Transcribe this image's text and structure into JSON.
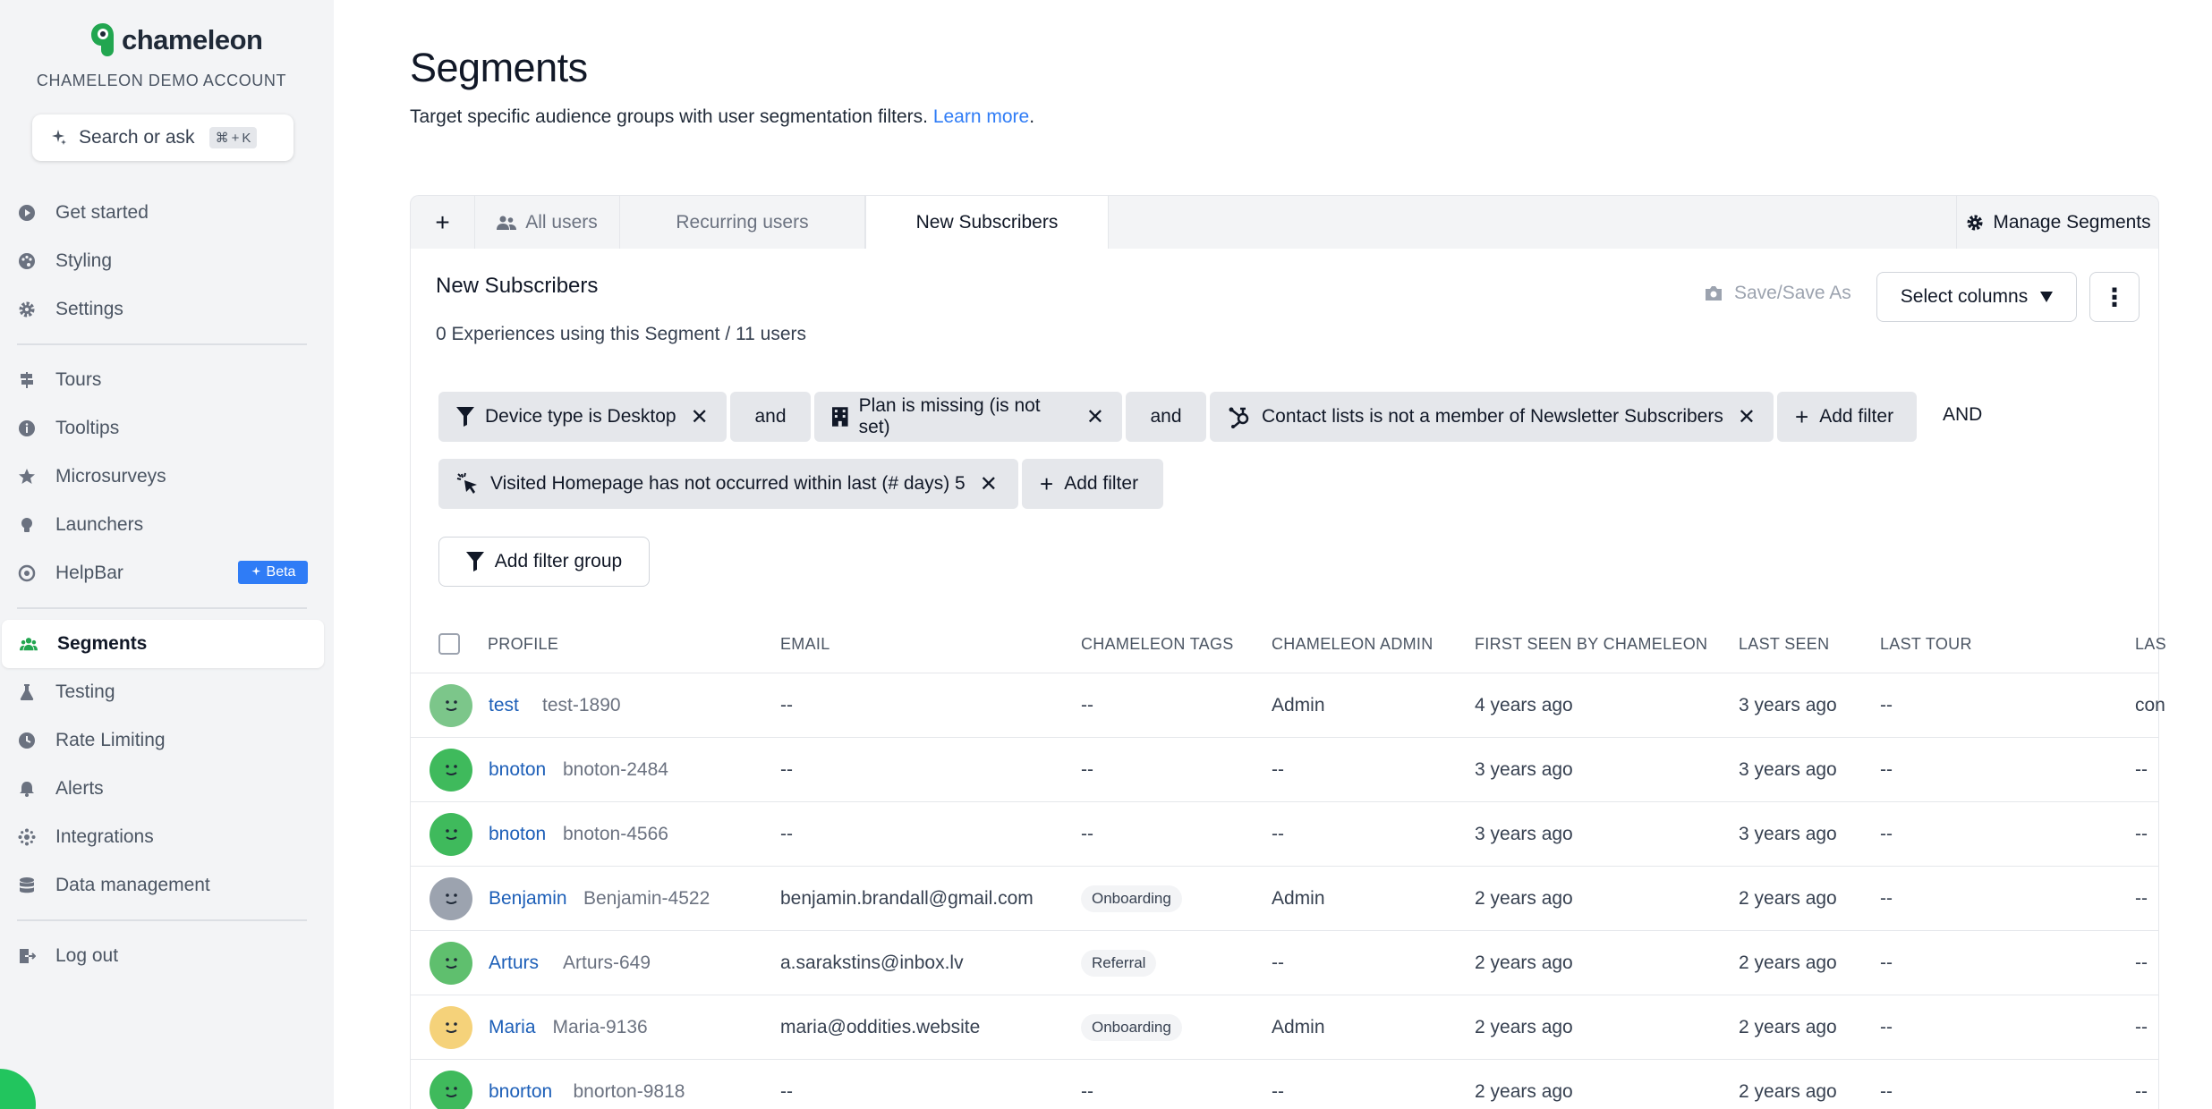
{
  "brand": {
    "name": "chameleon",
    "account": "CHAMELEON DEMO ACCOUNT",
    "accent": "#22a650",
    "link_color": "#2f7cf6"
  },
  "search": {
    "label": "Search or ask",
    "shortcut_cmd": "⌘",
    "shortcut_plus": "+",
    "shortcut_key": "K"
  },
  "nav": {
    "items": [
      {
        "label": "Get started",
        "icon": "play-icon"
      },
      {
        "label": "Styling",
        "icon": "palette-icon"
      },
      {
        "label": "Settings",
        "icon": "gear-icon"
      },
      {
        "label": "Tours",
        "icon": "signpost-icon"
      },
      {
        "label": "Tooltips",
        "icon": "info-icon"
      },
      {
        "label": "Microsurveys",
        "icon": "star-icon"
      },
      {
        "label": "Launchers",
        "icon": "lightbulb-icon"
      },
      {
        "label": "HelpBar",
        "icon": "helpbar-icon"
      },
      {
        "label": "Segments",
        "icon": "users-icon",
        "active": true
      },
      {
        "label": "Testing",
        "icon": "flask-icon"
      },
      {
        "label": "Rate Limiting",
        "icon": "clock-icon"
      },
      {
        "label": "Alerts",
        "icon": "bell-icon"
      },
      {
        "label": "Integrations",
        "icon": "integrations-icon"
      },
      {
        "label": "Data management",
        "icon": "database-icon"
      },
      {
        "label": "Log out",
        "icon": "logout-icon"
      }
    ],
    "beta_label": "Beta"
  },
  "page": {
    "title": "Segments",
    "subtitle": "Target specific audience groups with user segmentation filters.",
    "learn_more": "Learn more",
    "period": "."
  },
  "tabs": {
    "add": "+",
    "items": [
      "All users",
      "Recurring users",
      "New Subscribers"
    ],
    "manage": "Manage Segments"
  },
  "segment": {
    "name": "New Subscribers",
    "meta": "0 Experiences using this Segment / 11 users",
    "save_label": "Save/Save As",
    "select_columns": "Select columns",
    "more": "⋮"
  },
  "filters": {
    "row1": [
      {
        "label": "Device type is Desktop",
        "icon": "funnel-icon"
      },
      {
        "label": "and"
      },
      {
        "label": "Plan is missing (is not set)",
        "icon": "building-icon"
      },
      {
        "label": "and"
      },
      {
        "label": "Contact lists is not a member of Newsletter Subscribers",
        "icon": "hubspot-icon"
      }
    ],
    "add_filter": "Add filter",
    "group_and": "AND",
    "row2": [
      {
        "label": "Visited Homepage has not occurred within last (# days) 5",
        "icon": "click-icon"
      }
    ],
    "add_group": "Add filter group"
  },
  "table": {
    "headers": [
      "PROFILE",
      "EMAIL",
      "CHAMELEON TAGS",
      "CHAMELEON ADMIN",
      "FIRST SEEN BY CHAMELEON",
      "LAST SEEN",
      "LAST TOUR",
      "LAS"
    ],
    "rows": [
      {
        "name": "test",
        "id": "test-1890",
        "email": "--",
        "tag": "--",
        "admin": "Admin",
        "first": "4 years ago",
        "last": "3 years ago",
        "tour": "--",
        "extra": "con",
        "avatar": "#7cc68a"
      },
      {
        "name": "bnoton",
        "id": "bnoton-2484",
        "email": "--",
        "tag": "--",
        "admin": "--",
        "first": "3 years ago",
        "last": "3 years ago",
        "tour": "--",
        "extra": "--",
        "avatar": "#3fba5c"
      },
      {
        "name": "bnoton",
        "id": "bnoton-4566",
        "email": "--",
        "tag": "--",
        "admin": "--",
        "first": "3 years ago",
        "last": "3 years ago",
        "tour": "--",
        "extra": "--",
        "avatar": "#3fba5c"
      },
      {
        "name": "Benjamin",
        "id": "Benjamin-4522",
        "email": "benjamin.brandall@gmail.com",
        "tag": "Onboarding",
        "admin": "Admin",
        "first": "2 years ago",
        "last": "2 years ago",
        "tour": "--",
        "extra": "--",
        "avatar": "#9ca3af"
      },
      {
        "name": "Arturs",
        "id": "Arturs-649",
        "email": "a.sarakstins@inbox.lv",
        "tag": "Referral",
        "admin": "--",
        "first": "2 years ago",
        "last": "2 years ago",
        "tour": "--",
        "extra": "--",
        "avatar": "#5fbf6e"
      },
      {
        "name": "Maria",
        "id": "Maria-9136",
        "email": "maria@oddities.website",
        "tag": "Onboarding",
        "admin": "Admin",
        "first": "2 years ago",
        "last": "2 years ago",
        "tour": "--",
        "extra": "--",
        "avatar": "#f5d27a"
      },
      {
        "name": "bnorton",
        "id": "bnorton-9818",
        "email": "--",
        "tag": "--",
        "admin": "--",
        "first": "2 years ago",
        "last": "2 years ago",
        "tour": "--",
        "extra": "--",
        "avatar": "#3fba5c"
      }
    ]
  }
}
